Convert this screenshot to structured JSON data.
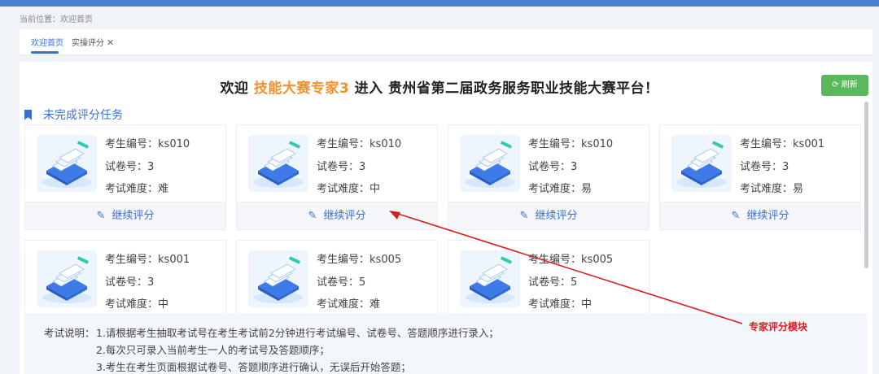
{
  "breadcrumb": {
    "label": "当前位置：",
    "current": "欢迎首页"
  },
  "tabs": [
    {
      "label": "欢迎首页",
      "active": true
    },
    {
      "label": "实操评分",
      "closable": true,
      "close": "✕"
    }
  ],
  "welcome": {
    "prefix": "欢迎 ",
    "name": "技能大赛专家3",
    "suffix": " 进入 贵州省第二届政务服务职业技能大赛平台！"
  },
  "refresh_button": {
    "icon": "⟳",
    "label": "刷新"
  },
  "section": {
    "title": "未完成评分任务"
  },
  "labels": {
    "candidate": "考生编号：",
    "paper": "试卷号：",
    "difficulty": "考试难度：",
    "continue": "继续评分"
  },
  "cards": [
    {
      "candidate_id": "ks010",
      "paper_no": "3",
      "difficulty": "难"
    },
    {
      "candidate_id": "ks010",
      "paper_no": "3",
      "difficulty": "中"
    },
    {
      "candidate_id": "ks010",
      "paper_no": "3",
      "difficulty": "易"
    },
    {
      "candidate_id": "ks001",
      "paper_no": "3",
      "difficulty": "易"
    },
    {
      "candidate_id": "ks001",
      "paper_no": "3",
      "difficulty": "中"
    },
    {
      "candidate_id": "ks005",
      "paper_no": "5",
      "difficulty": "难"
    },
    {
      "candidate_id": "ks005",
      "paper_no": "5",
      "difficulty": "中"
    }
  ],
  "notes": {
    "label": "考试说明：",
    "lines": [
      "1.请根据考生抽取考试号在考生考试前2分钟进行考试编号、试卷号、答题顺序进行录入；",
      "2.每次只可录入当前考生一人的考试号及答题顺序；",
      "3.考生在考生页面根据试卷号、答题顺序进行确认，无误后开始答题；"
    ]
  },
  "annotation": {
    "text": "专家评分模块",
    "color": "#d42020"
  },
  "colors": {
    "accent": "#3a6fd0",
    "highlight": "#f0922b",
    "refresh": "#5cb85c",
    "topbar": "#4a7fd6"
  }
}
